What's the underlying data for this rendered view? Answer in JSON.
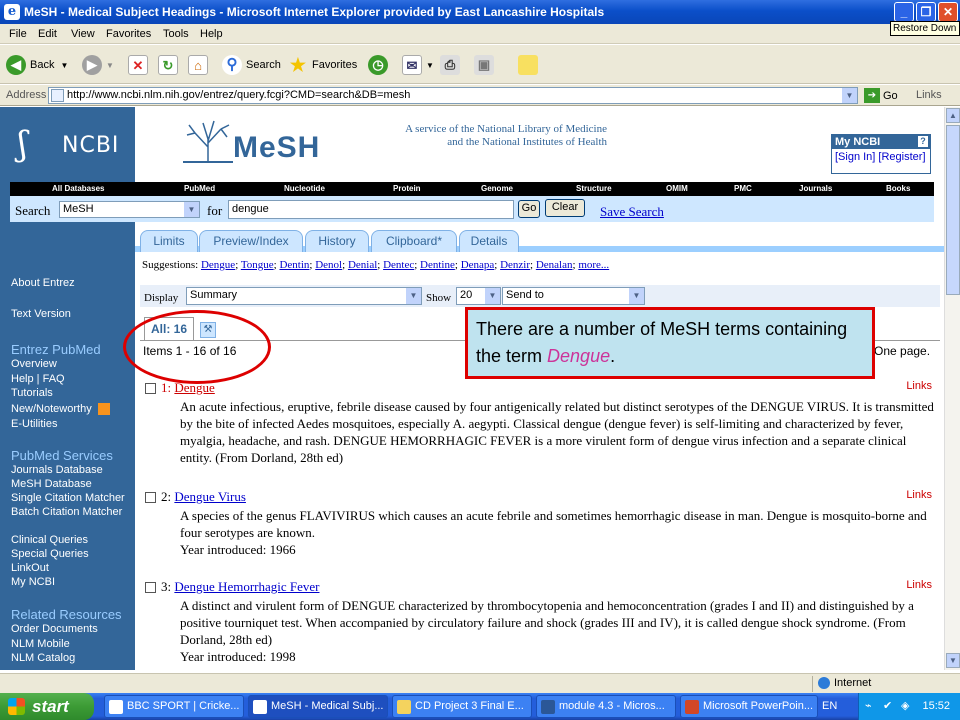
{
  "window": {
    "title": "MeSH - Medical Subject Headings - Microsoft Internet Explorer provided by East Lancashire Hospitals",
    "tooltip": "Restore Down"
  },
  "menu": [
    "File",
    "Edit",
    "View",
    "Favorites",
    "Tools",
    "Help"
  ],
  "toolbar": {
    "back": "Back",
    "search": "Search",
    "favorites": "Favorites"
  },
  "address": {
    "label": "Address",
    "url": "http://www.ncbi.nlm.nih.gov/entrez/query.fcgi?CMD=search&DB=mesh",
    "go": "Go",
    "links": "Links"
  },
  "ncbi": {
    "logo": "NCBI",
    "service_line1": "A service of the National Library of Medicine",
    "service_line2": "and the National Institutes of Health",
    "mesh_logo": "MeSH"
  },
  "myncbi": {
    "title": "My NCBI",
    "help": "?",
    "signin": "[Sign In]",
    "register": "[Register]"
  },
  "dbnav": [
    "All Databases",
    "PubMed",
    "Nucleotide",
    "Protein",
    "Genome",
    "Structure",
    "OMIM",
    "PMC",
    "Journals",
    "Books"
  ],
  "search": {
    "label": "Search",
    "db": "MeSH",
    "for_label": "for",
    "query": "dengue",
    "go": "Go",
    "clear": "Clear",
    "save": "Save Search"
  },
  "tabs": [
    "Limits",
    "Preview/Index",
    "History",
    "Clipboard*",
    "Details"
  ],
  "suggestions": {
    "label": "Suggestions:",
    "items": [
      "Dengue",
      "Tongue",
      "Dentin",
      "Denol",
      "Denial",
      "Dentec",
      "Dentine",
      "Denapa",
      "Denzir",
      "Denalan",
      "more..."
    ]
  },
  "display": {
    "label": "Display",
    "format": "Summary",
    "show_label": "Show",
    "count": "20",
    "send": "Send to"
  },
  "results_tab": {
    "all": "All: 16",
    "items": "Items 1 - 16 of 16",
    "onepage": "One page."
  },
  "callout": {
    "text1": "There are a number of MeSH terms containing the term ",
    "term": "Dengue",
    "text2": "."
  },
  "sidebar": {
    "about": "About Entrez",
    "text": "Text Version",
    "pubmed_header": "Entrez PubMed",
    "pubmed": [
      "Overview",
      "Help | FAQ",
      "Tutorials",
      "New/Noteworthy",
      "E-Utilities"
    ],
    "services_header": "PubMed Services",
    "services": [
      "Journals Database",
      "MeSH Database",
      "Single Citation Matcher",
      "Batch Citation Matcher",
      "Clinical Queries",
      "Special Queries",
      "LinkOut",
      "My NCBI"
    ],
    "related_header": "Related Resources",
    "related": [
      "Order Documents",
      "NLM Mobile",
      "NLM Catalog"
    ]
  },
  "results": [
    {
      "num": "1:",
      "title": "Dengue",
      "links": "Links",
      "desc": "An acute infectious, eruptive, febrile disease caused by four antigenically related but distinct serotypes of the DENGUE VIRUS. It is transmitted by the bite of infected Aedes mosquitoes, especially A. aegypti. Classical dengue (dengue fever) is self-limiting and characterized by fever, myalgia, headache, and rash. DENGUE HEMORRHAGIC FEVER is a more virulent form of dengue virus infection and a separate clinical entity. (From Dorland, 28th ed)"
    },
    {
      "num": "2:",
      "title": "Dengue Virus",
      "links": "Links",
      "desc": "A species of the genus FLAVIVIRUS which causes an acute febrile and sometimes hemorrhagic disease in man. Dengue is mosquito-borne and four serotypes are known.",
      "year": "Year introduced: 1966"
    },
    {
      "num": "3:",
      "title": "Dengue Hemorrhagic Fever",
      "links": "Links",
      "desc": "A distinct and virulent form of DENGUE characterized by thrombocytopenia and hemoconcentration (grades I and II) and distinguished by a positive tourniquet test. When accompanied by circulatory failure and shock (grades III and IV), it is called dengue shock syndrome. (From Dorland, 28th ed)",
      "year": "Year introduced: 1998"
    }
  ],
  "status": {
    "zone": "Internet"
  },
  "taskbar": {
    "start": "start",
    "tasks": [
      "BBC SPORT | Cricke...",
      "MeSH - Medical Subj...",
      "CD Project 3 Final E...",
      "module 4.3 - Micros...",
      "Microsoft PowerPoin..."
    ],
    "lang": "EN",
    "clock": "15:52"
  }
}
